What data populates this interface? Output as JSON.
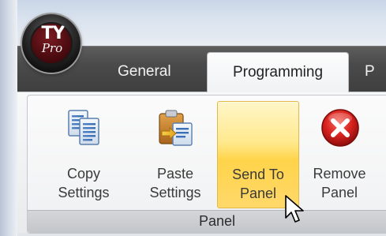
{
  "app": {
    "logo_main": "TY",
    "logo_sub": "Pro"
  },
  "tabs": [
    {
      "label": "General",
      "selected": false
    },
    {
      "label": "Programming",
      "selected": true
    },
    {
      "label": "P",
      "selected": false
    }
  ],
  "group": {
    "label": "Panel",
    "buttons": [
      {
        "line1": "Copy",
        "line2": "Settings",
        "icon": "copy-documents-icon"
      },
      {
        "line1": "Paste",
        "line2": "Settings",
        "icon": "paste-clipboard-icon"
      },
      {
        "line1": "Send To",
        "line2": "Panel",
        "icon": "none",
        "state": "hover"
      },
      {
        "line1": "Remove",
        "line2": "Panel",
        "icon": "red-x-remove-icon"
      }
    ]
  },
  "colors": {
    "ribbon_dark": "#4a4a4a",
    "hover_highlight": "#ffd44a",
    "remove_red": "#d9231f",
    "logo_red": "#6b1419"
  }
}
